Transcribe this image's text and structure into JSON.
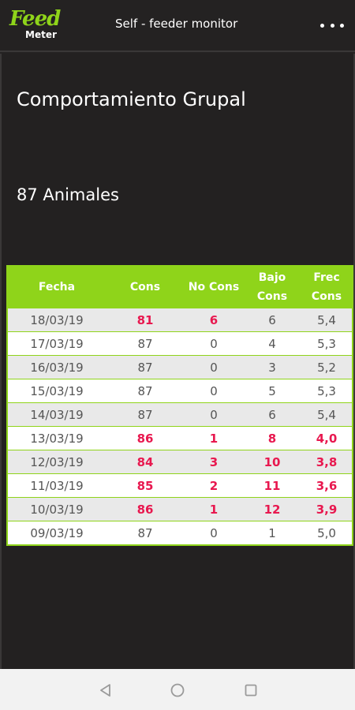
{
  "appbar": {
    "logo_top": "Feed",
    "logo_bottom": "Meter",
    "title": "Self - feeder monitor",
    "menu_icon": "more-horizontal-icon"
  },
  "main": {
    "section_title": "Comportamiento Grupal",
    "animal_count": "87 Animales"
  },
  "table": {
    "headers": {
      "fecha": "Fecha",
      "cons": "Cons",
      "nocons": "No Cons",
      "bajo": "Bajo Cons",
      "frec": "Frec Cons"
    },
    "rows": [
      {
        "fecha": "18/03/19",
        "cons": "81",
        "nocons": "6",
        "bajo": "6",
        "frec": "5,4",
        "alert_cons": true,
        "alert_nocons": true
      },
      {
        "fecha": "17/03/19",
        "cons": "87",
        "nocons": "0",
        "bajo": "4",
        "frec": "5,3"
      },
      {
        "fecha": "16/03/19",
        "cons": "87",
        "nocons": "0",
        "bajo": "3",
        "frec": "5,2"
      },
      {
        "fecha": "15/03/19",
        "cons": "87",
        "nocons": "0",
        "bajo": "5",
        "frec": "5,3"
      },
      {
        "fecha": "14/03/19",
        "cons": "87",
        "nocons": "0",
        "bajo": "6",
        "frec": "5,4"
      },
      {
        "fecha": "13/03/19",
        "cons": "86",
        "nocons": "1",
        "bajo": "8",
        "frec": "4,0",
        "alert": true
      },
      {
        "fecha": "12/03/19",
        "cons": "84",
        "nocons": "3",
        "bajo": "10",
        "frec": "3,8",
        "alert": true
      },
      {
        "fecha": "11/03/19",
        "cons": "85",
        "nocons": "2",
        "bajo": "11",
        "frec": "3,6",
        "alert": true
      },
      {
        "fecha": "10/03/19",
        "cons": "86",
        "nocons": "1",
        "bajo": "12",
        "frec": "3,9",
        "alert": true
      },
      {
        "fecha": "09/03/19",
        "cons": "87",
        "nocons": "0",
        "bajo": "1",
        "frec": "5,0"
      }
    ]
  },
  "colors": {
    "accent": "#8fd41a",
    "alert": "#e8184f",
    "background": "#242222"
  },
  "navbar": {
    "back_icon": "back-triangle-icon",
    "home_icon": "home-circle-icon",
    "recent_icon": "recent-square-icon"
  }
}
